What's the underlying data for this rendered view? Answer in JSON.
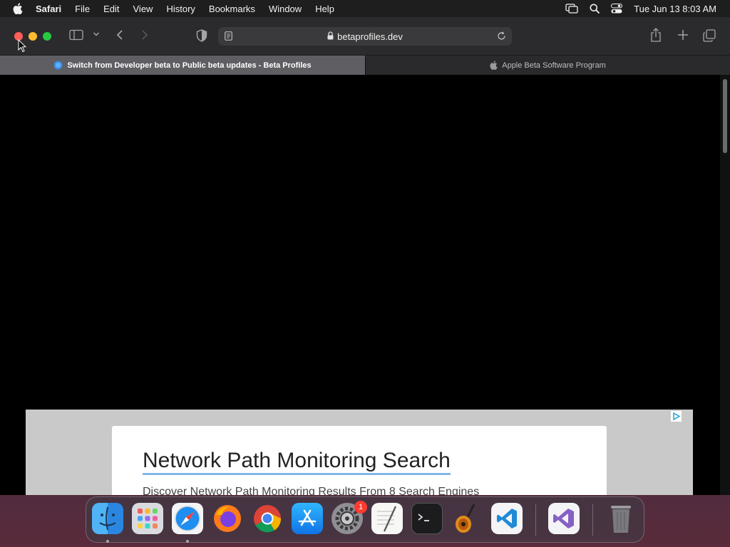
{
  "menubar": {
    "app_name": "Safari",
    "items": [
      "File",
      "Edit",
      "View",
      "History",
      "Bookmarks",
      "Window",
      "Help"
    ],
    "clock": "Tue Jun 13  8:03 AM"
  },
  "browser": {
    "url": "betaprofiles.dev",
    "tabs": [
      {
        "label": "Switch from Developer beta to Public beta updates - Beta Profiles",
        "active": true
      },
      {
        "label": "Apple Beta Software Program",
        "active": false
      }
    ]
  },
  "ad": {
    "headline": "Network Path Monitoring Search",
    "subline": "Discover Network Path Monitoring Results From 8 Search Engines"
  },
  "dock": {
    "apps": [
      "Finder",
      "Launchpad",
      "Safari",
      "Firefox",
      "Chrome",
      "App Store",
      "System Settings",
      "TextEdit",
      "Terminal",
      "GarageBand",
      "Visual Studio Code",
      "Visual Studio",
      "Trash"
    ],
    "settings_badge": "1"
  },
  "colors": {
    "close": "#ff5f57",
    "minimize": "#febc2e",
    "maximize": "#28c840",
    "ad_underline": "#7fb7e8"
  }
}
